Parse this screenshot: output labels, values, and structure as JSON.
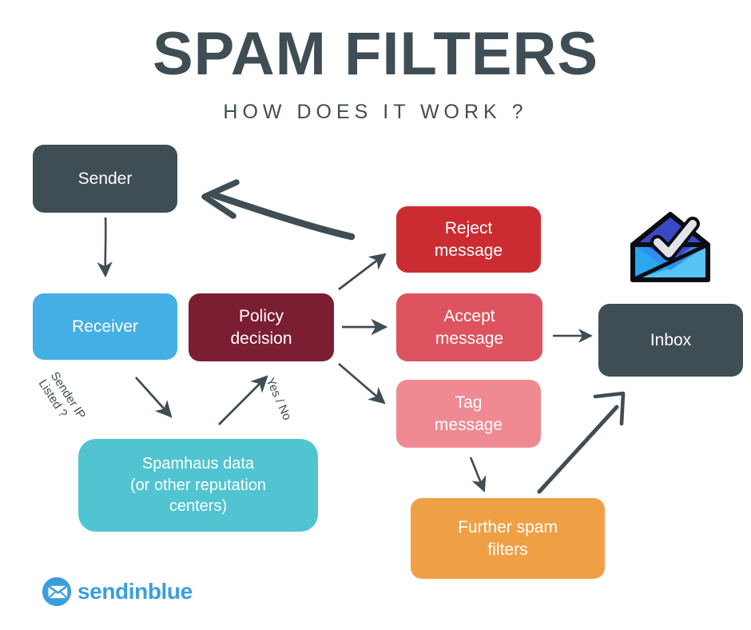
{
  "header": {
    "title": "SPAM FILTERS",
    "subtitle": "HOW DOES IT WORK ?"
  },
  "nodes": {
    "sender": {
      "label": "Sender",
      "color": "#3f4d54"
    },
    "receiver": {
      "label": "Receiver",
      "color": "#44afe4"
    },
    "policy": {
      "line1": "Policy",
      "line2": "decision",
      "color": "#7b1e32"
    },
    "spamhaus": {
      "line1": "Spamhaus data",
      "line2": "(or other reputation",
      "line3": "centers)",
      "color": "#51c4d1"
    },
    "reject": {
      "line1": "Reject",
      "line2": "message",
      "color": "#cb2c31"
    },
    "accept": {
      "line1": "Accept",
      "line2": "message",
      "color": "#de5360"
    },
    "tag": {
      "line1": "Tag",
      "line2": "message",
      "color": "#ef8a93"
    },
    "further": {
      "line1": "Further spam",
      "line2": "filters",
      "color": "#f0a044"
    },
    "inbox": {
      "label": "Inbox",
      "color": "#3f4d54"
    }
  },
  "edge_labels": {
    "sender_ip": {
      "line1": "Sender IP",
      "line2": "Listed ?"
    },
    "yes_no": "Yes / No"
  },
  "icons": {
    "envelope": "envelope-check-icon",
    "logo_mark": "sendinblue-envelope-logo-icon"
  },
  "logo": {
    "text": "sendinblue",
    "color": "#3a9ddd"
  },
  "chart_data": {
    "type": "diagram",
    "title": "SPAM FILTERS — HOW DOES IT WORK ?",
    "nodes": [
      {
        "id": "sender",
        "label": "Sender",
        "color": "#3f4d54"
      },
      {
        "id": "receiver",
        "label": "Receiver",
        "color": "#44afe4"
      },
      {
        "id": "policy",
        "label": "Policy decision",
        "color": "#7b1e32"
      },
      {
        "id": "spamhaus",
        "label": "Spamhaus data (or other reputation centers)",
        "color": "#51c4d1"
      },
      {
        "id": "reject",
        "label": "Reject message",
        "color": "#cb2c31"
      },
      {
        "id": "accept",
        "label": "Accept message",
        "color": "#de5360"
      },
      {
        "id": "tag",
        "label": "Tag message",
        "color": "#ef8a93"
      },
      {
        "id": "further",
        "label": "Further spam filters",
        "color": "#f0a044"
      },
      {
        "id": "inbox",
        "label": "Inbox",
        "color": "#3f4d54"
      }
    ],
    "edges": [
      {
        "from": "sender",
        "to": "receiver",
        "label": ""
      },
      {
        "from": "receiver",
        "to": "spamhaus",
        "label": "Sender IP Listed ?"
      },
      {
        "from": "spamhaus",
        "to": "policy",
        "label": "Yes / No"
      },
      {
        "from": "policy",
        "to": "reject",
        "label": ""
      },
      {
        "from": "policy",
        "to": "accept",
        "label": ""
      },
      {
        "from": "policy",
        "to": "tag",
        "label": ""
      },
      {
        "from": "reject",
        "to": "sender",
        "label": ""
      },
      {
        "from": "accept",
        "to": "inbox",
        "label": ""
      },
      {
        "from": "tag",
        "to": "further",
        "label": ""
      },
      {
        "from": "further",
        "to": "inbox",
        "label": ""
      }
    ]
  }
}
